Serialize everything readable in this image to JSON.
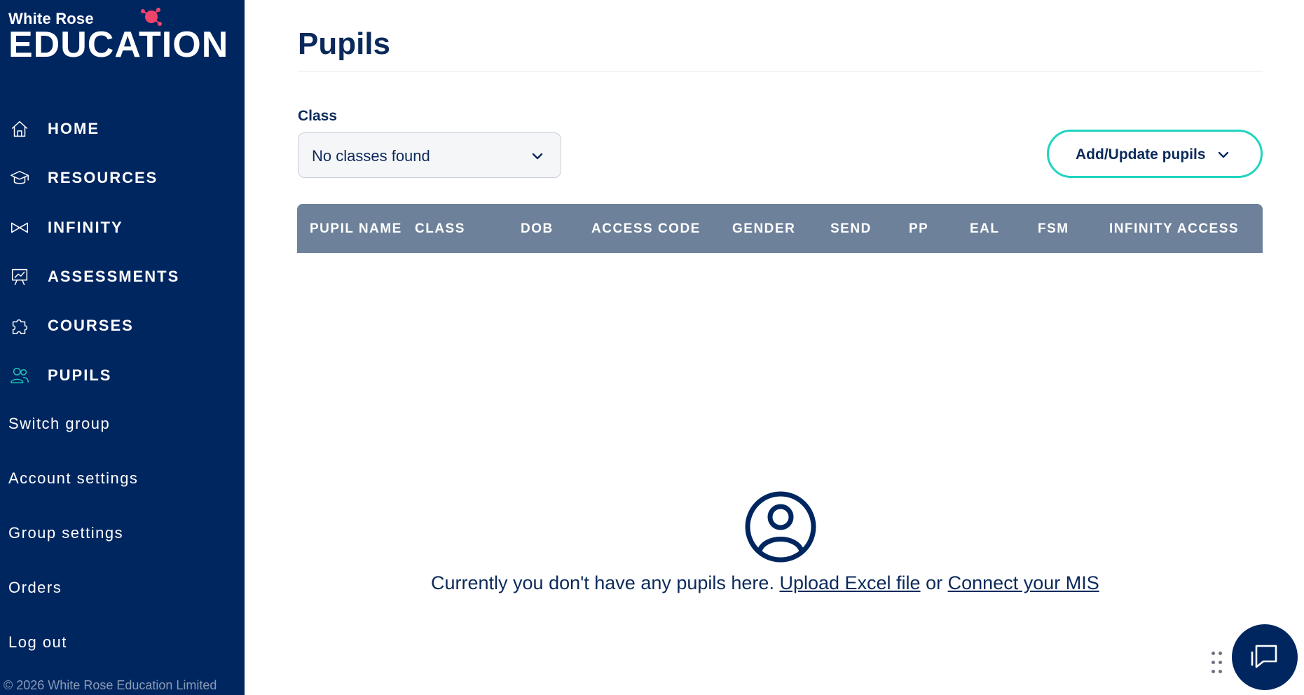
{
  "brand": {
    "top_line": "White Rose",
    "main_line": "EDUCATION"
  },
  "sidebar": {
    "nav_items": [
      {
        "label": "HOME",
        "icon": "home-icon",
        "active": false
      },
      {
        "label": "RESOURCES",
        "icon": "graduation-cap-icon",
        "active": false
      },
      {
        "label": "INFINITY",
        "icon": "infinity-icon",
        "active": false
      },
      {
        "label": "ASSESSMENTS",
        "icon": "presentation-chart-icon",
        "active": false
      },
      {
        "label": "COURSES",
        "icon": "puzzle-icon",
        "active": false
      },
      {
        "label": "PUPILS",
        "icon": "users-icon",
        "active": true
      }
    ],
    "links": [
      "Switch group",
      "Account settings",
      "Group settings",
      "Orders",
      "Log out"
    ],
    "copyright": "© 2026 White Rose Education Limited"
  },
  "main": {
    "title": "Pupils",
    "class_filter": {
      "label": "Class",
      "selected": "No classes found"
    },
    "add_button_label": "Add/Update pupils",
    "table": {
      "columns": [
        "PUPIL NAME",
        "CLASS",
        "DOB",
        "ACCESS CODE",
        "GENDER",
        "SEND",
        "PP",
        "EAL",
        "FSM",
        "INFINITY ACCESS"
      ],
      "rows": []
    },
    "empty_state": {
      "message": "Currently you don't have any pupils here.",
      "upload_link": "Upload Excel file",
      "conjunction": "or",
      "mis_link": "Connect your MIS"
    }
  },
  "colors": {
    "sidebar_bg": "#002660",
    "accent": "#20d4c0",
    "table_header_bg": "#6e819a",
    "text_primary": "#0b2a5b"
  }
}
